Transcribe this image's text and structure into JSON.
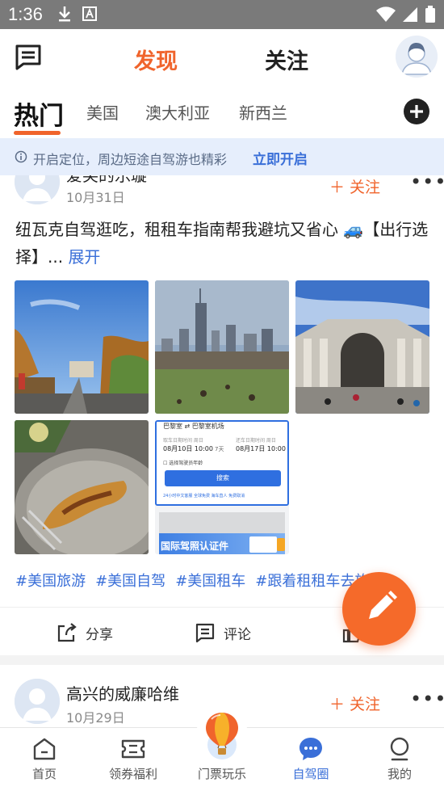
{
  "status_bar": {
    "time": "1:36"
  },
  "header": {
    "tab_discover": "发现",
    "tab_follow": "关注"
  },
  "categories": {
    "items": [
      "热门",
      "美国",
      "澳大利亚",
      "新西兰"
    ],
    "active": "热门"
  },
  "banner": {
    "text": "开启定位，周边短途自驾游也精彩",
    "link": "立即开启"
  },
  "post1": {
    "author": "爱笑的乐璇",
    "date": "10月31日",
    "follow_label": "关注",
    "text": "纽瓦克自驾逛吃，租租车指南帮我避坑又省心 🚙【出行选择】... ",
    "expand_label": "展开",
    "hashtags": [
      "#美国旅游",
      "#美国自驾",
      "#美国租车",
      "#跟着租租车去旅游"
    ],
    "actions": {
      "share": "分享",
      "comment": "评论"
    },
    "screenshot": {
      "location_from": "巴黎室",
      "location_to": "巴黎室机场",
      "pickup_label": "取车日期时间 周日",
      "pickup": "08月10日 10:00",
      "duration": "7天",
      "return_label": "还车日期时间 周日",
      "return": "08月17日 10:00",
      "checkbox": "选择驾驶员年龄",
      "search": "搜索",
      "footer": "24小时中文客服  全球免费  海车直人  免费取消",
      "license": "国际驾照认证件"
    }
  },
  "post2": {
    "author": "高兴的威廉哈维",
    "date": "10月29日",
    "follow_label": "关注"
  },
  "bottom_nav": [
    {
      "label": "首页",
      "icon": "home-icon"
    },
    {
      "label": "领券福利",
      "icon": "coupon-icon"
    },
    {
      "label": "门票玩乐",
      "icon": "balloon-icon"
    },
    {
      "label": "自驾圈",
      "icon": "chat-bubble-icon",
      "active": true
    },
    {
      "label": "我的",
      "icon": "profile-icon"
    }
  ],
  "colors": {
    "accent": "#f0642c",
    "link": "#3a6fd8",
    "banner_bg": "#e6eefc"
  }
}
